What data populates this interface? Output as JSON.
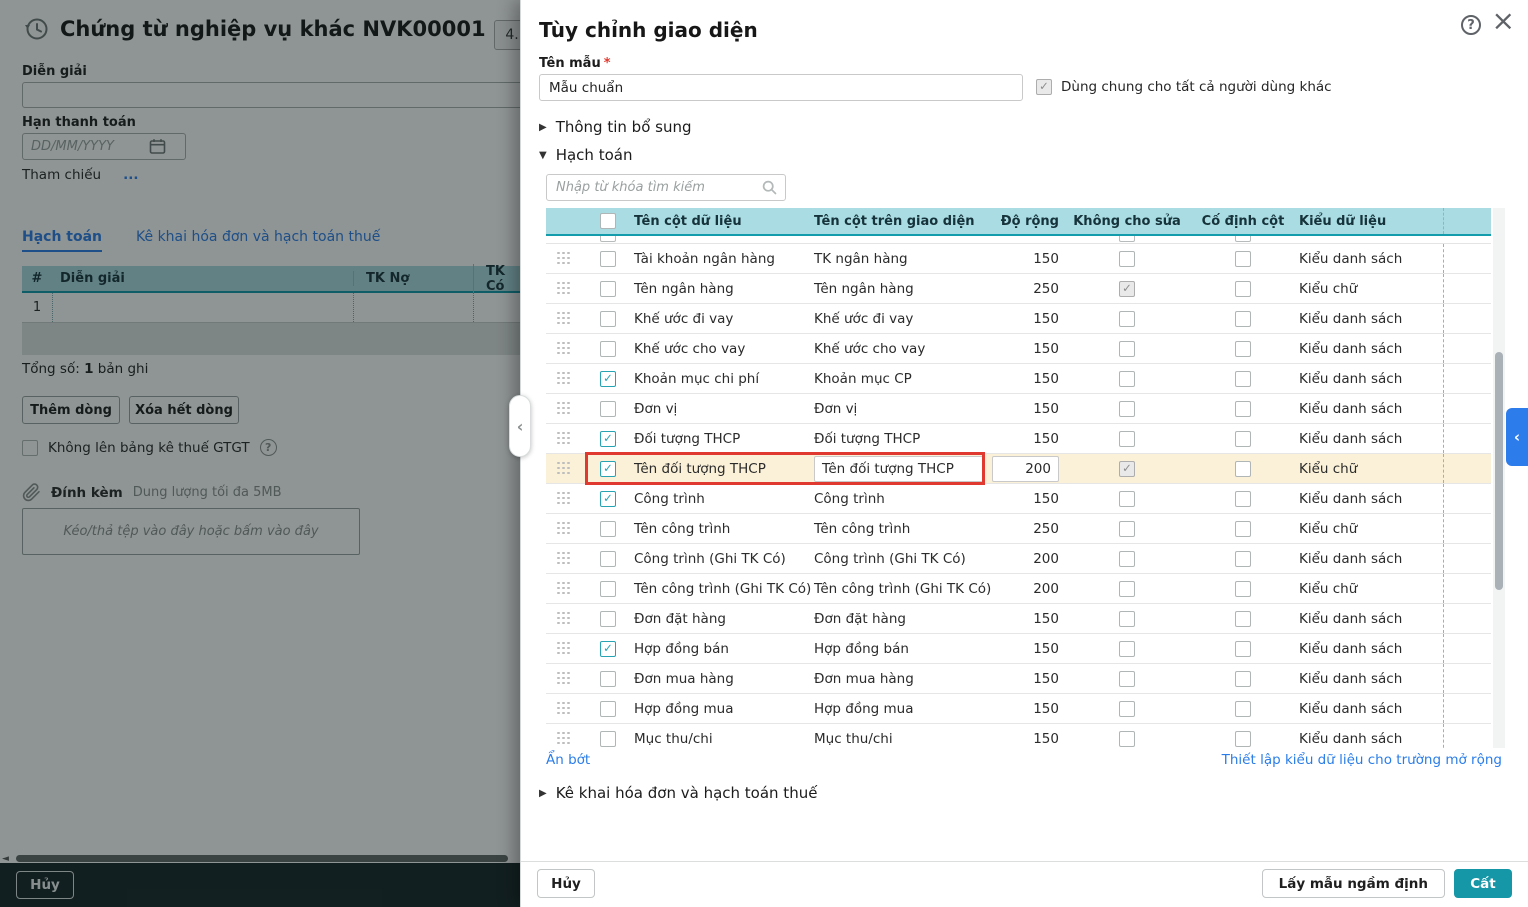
{
  "colors": {
    "accent_teal": "#1697a7",
    "grid_header_teal": "#a9dce3",
    "link_blue": "#2a7de9",
    "highlight_row_bg": "#fbf1d8",
    "highlight_border_red": "#e03a30",
    "side_handle_blue": "#2d7cec",
    "required_red": "#e03b30"
  },
  "left_panel": {
    "title": "Chứng từ nghiệp vụ khác NVK00001",
    "badge": "4.",
    "fields": {
      "description_label": "Diễn giải",
      "due_date_label": "Hạn thanh toán",
      "date_placeholder": "DD/MM/YYYY",
      "reference_label": "Tham chiếu",
      "reference_more": "..."
    },
    "tabs": [
      {
        "label": "Hạch toán"
      },
      {
        "label": "Kê khai hóa đơn và hạch toán thuế"
      }
    ],
    "grid": {
      "headers": [
        "#",
        "Diễn giải",
        "TK Nợ",
        "TK Có"
      ],
      "row_number": "1"
    },
    "total_prefix": "Tổng số:",
    "total_count": "1",
    "total_suffix": "bản ghi",
    "add_row_button": "Thêm dòng",
    "clear_rows_button": "Xóa hết dòng",
    "gtgt_checkbox_label": "Không lên bảng kê thuế GTGT",
    "attach_label": "Đính kèm",
    "attach_hint": "Dung lượng tối đa 5MB",
    "dropzone_text": "Kéo/thả tệp vào đây hoặc bấm vào đây",
    "cancel_button": "Hủy"
  },
  "drawer": {
    "title": "Tùy chỉnh giao diện",
    "help_glyph": "?",
    "close_glyph": "×",
    "template_name_label": "Tên mẫu",
    "required_mark": "*",
    "template_name_value": "Mẫu chuẩn",
    "share_checkbox_label": "Dùng chung cho tất cả người dùng khác",
    "share_checkbox_checked": true,
    "sections": {
      "additional_info": "Thông tin bổ sung",
      "accounting": "Hạch toán",
      "tax_declaration": "Kê khai hóa đơn và hạch toán thuế"
    },
    "search_placeholder": "Nhập từ khóa tìm kiếm",
    "table": {
      "headers": [
        "Tên cột dữ liệu",
        "Tên cột trên giao diện",
        "Độ rộng",
        "Không cho sửa",
        "Cố định cột",
        "Kiểu dữ liệu"
      ],
      "rows": [
        {
          "checked": false,
          "name": "Tài khoản ngân hàng",
          "display": "TK ngân hàng",
          "width": "150",
          "no_edit": false,
          "fixed": false,
          "type": "Kiểu danh sách",
          "highlighted": false
        },
        {
          "checked": false,
          "name": "Tên ngân hàng",
          "display": "Tên ngân hàng",
          "width": "250",
          "no_edit": true,
          "fixed": false,
          "type": "Kiểu chữ",
          "highlighted": false
        },
        {
          "checked": false,
          "name": "Khế ước đi vay",
          "display": "Khế ước đi vay",
          "width": "150",
          "no_edit": false,
          "fixed": false,
          "type": "Kiểu danh sách",
          "highlighted": false
        },
        {
          "checked": false,
          "name": "Khế ước cho vay",
          "display": "Khế ước cho vay",
          "width": "150",
          "no_edit": false,
          "fixed": false,
          "type": "Kiểu danh sách",
          "highlighted": false
        },
        {
          "checked": true,
          "name": "Khoản mục chi phí",
          "display": "Khoản mục CP",
          "width": "150",
          "no_edit": false,
          "fixed": false,
          "type": "Kiểu danh sách",
          "highlighted": false
        },
        {
          "checked": false,
          "name": "Đơn vị",
          "display": "Đơn vị",
          "width": "150",
          "no_edit": false,
          "fixed": false,
          "type": "Kiểu danh sách",
          "highlighted": false
        },
        {
          "checked": true,
          "name": "Đối tượng THCP",
          "display": "Đối tượng THCP",
          "width": "150",
          "no_edit": false,
          "fixed": false,
          "type": "Kiểu danh sách",
          "highlighted": false
        },
        {
          "checked": true,
          "name": "Tên đối tượng THCP",
          "display": "Tên đối tượng THCP",
          "width": "200",
          "no_edit": true,
          "fixed": false,
          "type": "Kiểu chữ",
          "highlighted": true
        },
        {
          "checked": true,
          "name": "Công trình",
          "display": "Công trình",
          "width": "150",
          "no_edit": false,
          "fixed": false,
          "type": "Kiểu danh sách",
          "highlighted": false
        },
        {
          "checked": false,
          "name": "Tên công trình",
          "display": "Tên công trình",
          "width": "250",
          "no_edit": false,
          "fixed": false,
          "type": "Kiểu chữ",
          "highlighted": false
        },
        {
          "checked": false,
          "name": "Công trình (Ghi TK Có)",
          "display": "Công trình (Ghi TK Có)",
          "width": "200",
          "no_edit": false,
          "fixed": false,
          "type": "Kiểu danh sách",
          "highlighted": false
        },
        {
          "checked": false,
          "name": "Tên công trình (Ghi TK Có)",
          "display": "Tên công trình (Ghi TK Có)",
          "width": "200",
          "no_edit": false,
          "fixed": false,
          "type": "Kiểu chữ",
          "highlighted": false
        },
        {
          "checked": false,
          "name": "Đơn đặt hàng",
          "display": "Đơn đặt hàng",
          "width": "150",
          "no_edit": false,
          "fixed": false,
          "type": "Kiểu danh sách",
          "highlighted": false
        },
        {
          "checked": true,
          "name": "Hợp đồng bán",
          "display": "Hợp đồng bán",
          "width": "150",
          "no_edit": false,
          "fixed": false,
          "type": "Kiểu danh sách",
          "highlighted": false
        },
        {
          "checked": false,
          "name": "Đơn mua hàng",
          "display": "Đơn mua hàng",
          "width": "150",
          "no_edit": false,
          "fixed": false,
          "type": "Kiểu danh sách",
          "highlighted": false
        },
        {
          "checked": false,
          "name": "Hợp đồng mua",
          "display": "Hợp đồng mua",
          "width": "150",
          "no_edit": false,
          "fixed": false,
          "type": "Kiểu danh sách",
          "highlighted": false
        },
        {
          "checked": false,
          "name": "Mục thu/chi",
          "display": "Mục thu/chi",
          "width": "150",
          "no_edit": false,
          "fixed": false,
          "type": "Kiểu danh sách",
          "highlighted": false
        }
      ]
    },
    "hide_link": "Ẩn bớt",
    "setup_type_link": "Thiết lập kiểu dữ liệu cho trường mở rộng",
    "footer": {
      "cancel_button": "Hủy",
      "default_template_button": "Lấy mẫu ngầm định",
      "save_button": "Cất"
    }
  }
}
